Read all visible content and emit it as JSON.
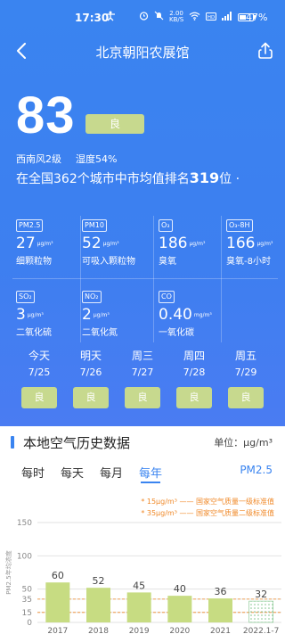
{
  "status_bar": {
    "time": "17:30",
    "app_icon": "accessibility-icon",
    "net_speed_top": "2.00",
    "net_speed_bottom": "KB/S",
    "battery_percent": "47%"
  },
  "nav": {
    "title": "北京朝阳农展馆"
  },
  "aqi": {
    "value": "83",
    "level": "良",
    "wind": "西南风2级",
    "humidity": "湿度54%",
    "rank_prefix": "在全国362个城市中市均值排名",
    "rank_value": "319",
    "rank_suffix": "位 ·"
  },
  "pollutants": [
    {
      "label": "PM2.5",
      "value": "27",
      "unit": "μg/m³",
      "name": "细颗粒物"
    },
    {
      "label": "PM10",
      "value": "52",
      "unit": "μg/m³",
      "name": "可吸入颗粒物"
    },
    {
      "label": "O₃",
      "value": "186",
      "unit": "μg/m³",
      "name": "臭氧"
    },
    {
      "label": "O₃-8H",
      "value": "166",
      "unit": "μg/m³",
      "name": "臭氧-8小时"
    },
    {
      "label": "SO₂",
      "value": "3",
      "unit": "μg/m³",
      "name": "二氧化硫"
    },
    {
      "label": "NO₂",
      "value": "2",
      "unit": "μg/m³",
      "name": "二氧化氮"
    },
    {
      "label": "CO",
      "value": "0.40",
      "unit": "mg/m³",
      "name": "一氧化碳"
    }
  ],
  "forecast": [
    {
      "day": "今天",
      "date": "7/25",
      "level": "良"
    },
    {
      "day": "明天",
      "date": "7/26",
      "level": "良"
    },
    {
      "day": "周三",
      "date": "7/27",
      "level": "良"
    },
    {
      "day": "周四",
      "date": "7/28",
      "level": "良"
    },
    {
      "day": "周五",
      "date": "7/29",
      "level": "良"
    }
  ],
  "history": {
    "title": "本地空气历史数据",
    "unit_label": "单位：μg/m³",
    "tabs": [
      "每时",
      "每天",
      "每月",
      "每年"
    ],
    "active_tab": "每年",
    "pollutant": "PM2.5",
    "standard_1": "* 15μg/m³ —— 国家空气质量一级标准值",
    "standard_2": "* 35μg/m³ —— 国家空气质量二级标准值"
  },
  "colors": {
    "hero_bg": "#3d7ff0",
    "level_good": "#c7d98e",
    "accent": "#3a84f0",
    "standard_line": "#f08a2a",
    "bar_fill": "#c7dc82"
  },
  "chart_data": {
    "type": "bar",
    "ylabel": "PM2.5年均浓度",
    "yticks": [
      0,
      15,
      35,
      50,
      100,
      150
    ],
    "ylim": [
      0,
      150
    ],
    "categories": [
      "2017",
      "2018",
      "2019",
      "2020",
      "2021",
      "2022.1-7"
    ],
    "values": [
      60,
      52,
      45,
      40,
      36,
      32
    ],
    "partial_last": true,
    "reference_lines": [
      15,
      35
    ]
  }
}
